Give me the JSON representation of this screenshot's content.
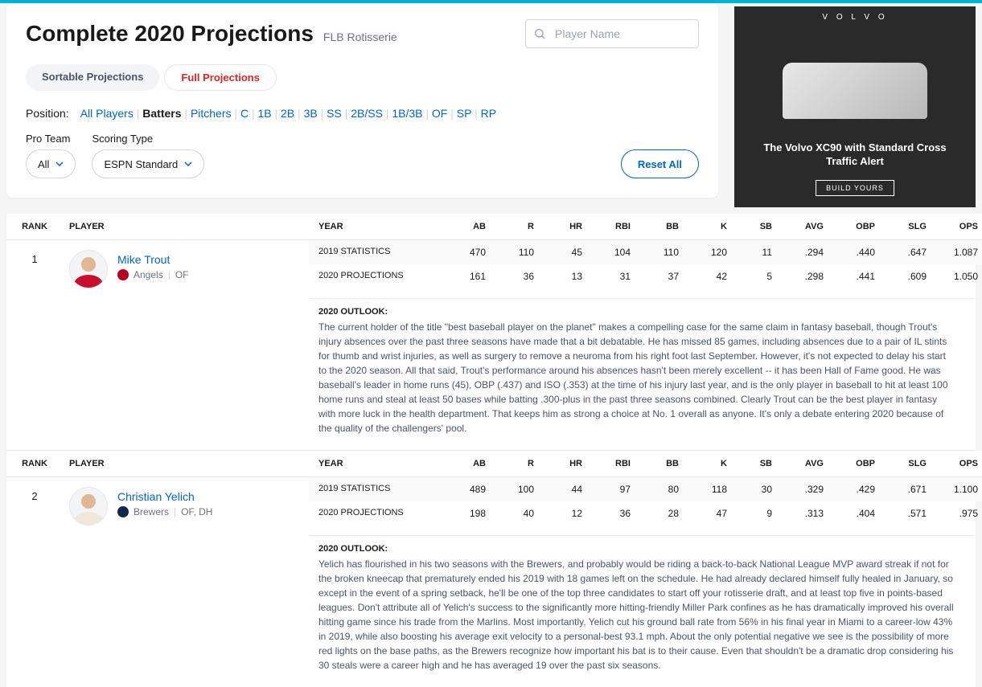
{
  "header": {
    "title": "Complete 2020 Projections",
    "subtitle": "FLB Rotisserie",
    "search_placeholder": "Player Name"
  },
  "tabs": {
    "sortable": "Sortable Projections",
    "full": "Full Projections"
  },
  "positions": {
    "label": "Position:",
    "items": [
      "All Players",
      "Batters",
      "Pitchers",
      "C",
      "1B",
      "2B",
      "3B",
      "SS",
      "2B/SS",
      "1B/3B",
      "OF",
      "SP",
      "RP"
    ],
    "active_index": 1
  },
  "filters": {
    "pro_team_label": "Pro Team",
    "pro_team_value": "All",
    "scoring_label": "Scoring Type",
    "scoring_value": "ESPN Standard",
    "reset": "Reset All"
  },
  "ad": {
    "brand": "V O L V O",
    "text": "The Volvo XC90 with Standard Cross Traffic Alert",
    "button": "BUILD YOURS"
  },
  "columns": {
    "rank": "RANK",
    "player": "PLAYER",
    "year": "YEAR",
    "ab": "AB",
    "r": "R",
    "hr": "HR",
    "rbi": "RBI",
    "bb": "BB",
    "k": "K",
    "sb": "SB",
    "avg": "AVG",
    "obp": "OBP",
    "slg": "SLG",
    "ops": "OPS"
  },
  "stat_labels": {
    "stats_2019": "2019 STATISTICS",
    "proj_2020": "2020 PROJECTIONS",
    "outlook_title": "2020 OUTLOOK:"
  },
  "players": [
    {
      "rank": "1",
      "name": "Mike Trout",
      "team": "Angels",
      "pos": "OF",
      "team_class": "angels",
      "body_class": "red",
      "stats_2019": {
        "ab": "470",
        "r": "110",
        "hr": "45",
        "rbi": "104",
        "bb": "110",
        "k": "120",
        "sb": "11",
        "avg": ".294",
        "obp": ".440",
        "slg": ".647",
        "ops": "1.087"
      },
      "proj_2020": {
        "ab": "161",
        "r": "36",
        "hr": "13",
        "rbi": "31",
        "bb": "37",
        "k": "42",
        "sb": "5",
        "avg": ".298",
        "obp": ".441",
        "slg": ".609",
        "ops": "1.050"
      },
      "outlook": "The current holder of the title \"best baseball player on the planet\" makes a compelling case for the same claim in fantasy baseball, though Trout's injury absences over the past three seasons have made that a bit debatable. He has missed 85 games, including absences due to a pair of IL stints for thumb and wrist injuries, as well as surgery to remove a neuroma from his right foot last September. However, it's not expected to delay his start to the 2020 season. All that said, Trout's performance around his absences hasn't been merely excellent -- it has been Hall of Fame good. He was baseball's leader in home runs (45), OBP (.437) and ISO (.353) at the time of his injury last year, and is the only player in baseball to hit at least 100 home runs and steal at least 50 bases while batting .300-plus in the past three seasons combined. Clearly Trout can be the best player in fantasy with more luck in the health department. That keeps him as strong a choice at No. 1 overall as anyone. It's only a debate entering 2020 because of the quality of the challengers' pool."
    },
    {
      "rank": "2",
      "name": "Christian Yelich",
      "team": "Brewers",
      "pos": "OF, DH",
      "team_class": "brewers",
      "body_class": "cream",
      "stats_2019": {
        "ab": "489",
        "r": "100",
        "hr": "44",
        "rbi": "97",
        "bb": "80",
        "k": "118",
        "sb": "30",
        "avg": ".329",
        "obp": ".429",
        "slg": ".671",
        "ops": "1.100"
      },
      "proj_2020": {
        "ab": "198",
        "r": "40",
        "hr": "12",
        "rbi": "36",
        "bb": "28",
        "k": "47",
        "sb": "9",
        "avg": ".313",
        "obp": ".404",
        "slg": ".571",
        "ops": ".975"
      },
      "outlook": "Yelich has flourished in his two seasons with the Brewers, and probably would be riding a back-to-back National League MVP award streak if not for the broken kneecap that prematurely ended his 2019 with 18 games left on the schedule. He had already declared himself fully healed in January, so except in the event of a spring setback, he'll be one of the top three candidates to start off your rotisserie draft, and at least top five in points-based leagues. Don't attribute all of Yelich's success to the significantly more hitting-friendly Miller Park confines as he has dramatically improved his overall hitting game since his trade from the Marlins. Most importantly, Yelich cut his ground ball rate from 56% in his final year in Miami to a career-low 43% in 2019, while also boosting his average exit velocity to a personal-best 93.1 mph. About the only potential negative we see is the possibility of more red lights on the base paths, as the Brewers recognize how important his bat is to their cause. Even that shouldn't be a dramatic drop considering his 30 steals were a career high and he has averaged 19 over the past six seasons."
    }
  ]
}
